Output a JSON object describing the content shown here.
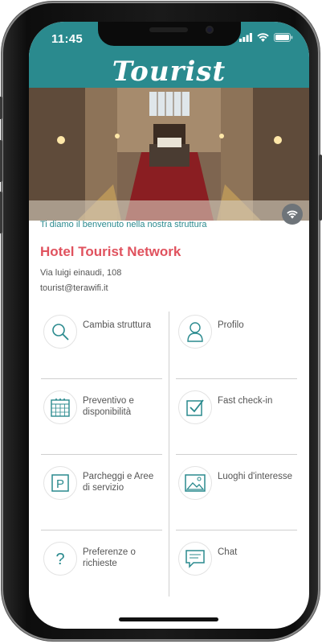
{
  "status": {
    "time": "11:45"
  },
  "header": {
    "brand": "Tourist",
    "brand_color": "#2a8a8e"
  },
  "welcome": "Ti diamo il benvenuto nella nostra struttura",
  "hotel": {
    "name": "Hotel Tourist Network",
    "address": "Via luigi einaudi, 108",
    "email": "tourist@terawifi.it",
    "accent": "#e0525e"
  },
  "menu": {
    "left": [
      {
        "label": "Cambia struttura",
        "icon": "search-icon"
      },
      {
        "label": "Preventivo e disponibilità",
        "icon": "calendar-icon"
      },
      {
        "label": "Parcheggi e Aree di servizio",
        "icon": "parking-icon"
      },
      {
        "label": "Preferenze o richieste",
        "icon": "question-icon"
      }
    ],
    "right": [
      {
        "label": "Profilo",
        "icon": "user-icon"
      },
      {
        "label": "Fast check-in",
        "icon": "checkbox-icon"
      },
      {
        "label": "Luoghi d'interesse",
        "icon": "image-icon"
      },
      {
        "label": "Chat",
        "icon": "chat-icon"
      }
    ]
  }
}
